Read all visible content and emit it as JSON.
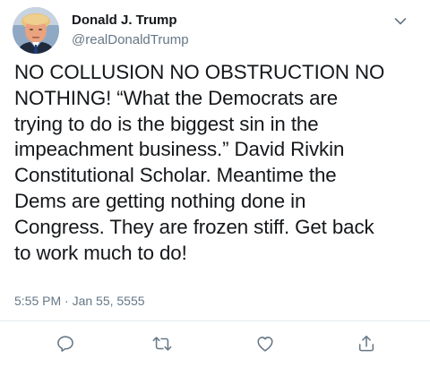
{
  "author": {
    "display_name": "Donald J. Trump",
    "handle": "@realDonaldTrump"
  },
  "tweet": {
    "text_lines": [
      "NO COLLUSION NO OBSTRUCTION NO",
      "NOTHING! “What the Democrats are",
      "trying to do is the biggest sin in the",
      "impeachment business.” David Rivkin",
      "Constitutional Scholar. Meantime the",
      "Dems are getting nothing done in",
      "Congress. They are frozen stiff. Get back",
      "to work much to do!"
    ],
    "timestamp": "5:55 PM · Jan 55, 5555"
  },
  "actions": [
    {
      "name": "reply",
      "icon": "reply-icon"
    },
    {
      "name": "retweet",
      "icon": "retweet-icon"
    },
    {
      "name": "like",
      "icon": "heart-icon"
    },
    {
      "name": "share",
      "icon": "share-icon"
    }
  ],
  "colors": {
    "text_primary": "#14171a",
    "text_secondary": "#657786",
    "divider": "#e6ecf0",
    "icon": "#657786"
  }
}
